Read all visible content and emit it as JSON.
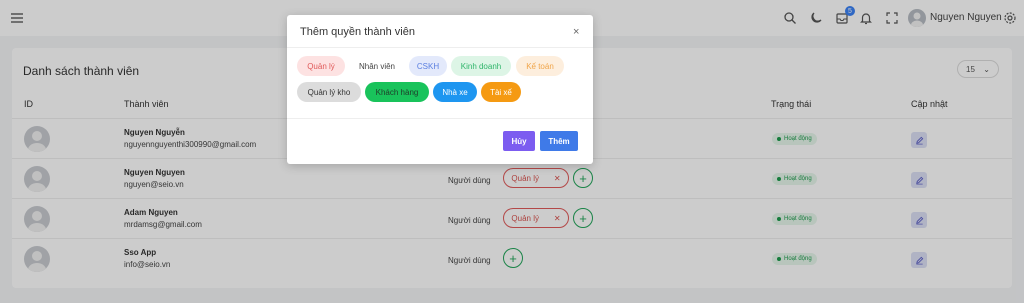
{
  "header": {
    "notification_count": "5",
    "user_name": "Nguyen Nguyen"
  },
  "card": {
    "title": "Danh sách thành viên",
    "page_size": "15",
    "columns": [
      "ID",
      "Thành viên",
      "Trạng thái",
      "Cập nhật"
    ]
  },
  "rows": [
    {
      "name": "Nguyen Nguyễn",
      "email": "nguyennguyenthi300990@gmail.com",
      "type": "",
      "role": "",
      "status": "Hoạt động"
    },
    {
      "name": "Nguyen Nguyen",
      "email": "nguyen@seio.vn",
      "type": "Người dùng",
      "role": "Quản lý",
      "status": "Hoạt động"
    },
    {
      "name": "Adam Nguyen",
      "email": "mrdamsg@gmail.com",
      "type": "Người dùng",
      "role": "Quản lý",
      "status": "Hoạt động"
    },
    {
      "name": "Sso App",
      "email": "info@seio.vn",
      "type": "Người dùng",
      "role": "",
      "status": "Hoạt động"
    }
  ],
  "modal": {
    "title": "Thêm quyền thành viên",
    "close": "×",
    "tags": [
      {
        "label": "Quản lý",
        "bg": "#fde2e2",
        "fg": "#e05a5a"
      },
      {
        "label": "Nhân viên",
        "bg": "#ffffff",
        "fg": "#444444"
      },
      {
        "label": "CSKH",
        "bg": "#e3e9fb",
        "fg": "#5b7fe0"
      },
      {
        "label": "Kinh doanh",
        "bg": "#ddf5e6",
        "fg": "#2fb56a"
      },
      {
        "label": "Kế toán",
        "bg": "#fdeedd",
        "fg": "#f0a54a"
      },
      {
        "label": "Quản lý kho",
        "bg": "#dcdcdc",
        "fg": "#333333"
      },
      {
        "label": "Khách hàng",
        "bg": "#19c35b",
        "fg": "#1f3d2a"
      },
      {
        "label": "Nhà xe",
        "bg": "#1e96f0",
        "fg": "#ffffff"
      },
      {
        "label": "Tài xế",
        "bg": "#f59a12",
        "fg": "#ffffff"
      }
    ],
    "cancel_label": "Hủy",
    "add_label": "Thêm"
  },
  "colors": {
    "cancel_button": "#7c5cf0",
    "add_button": "#3f7ae8",
    "status_green": "#1c9a4b",
    "role_red": "#e05a5a"
  }
}
